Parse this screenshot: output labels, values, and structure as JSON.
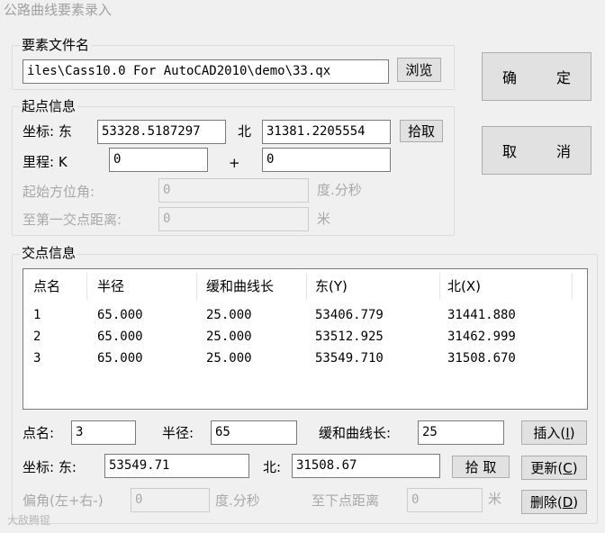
{
  "window": {
    "title": "公路曲线要素录入"
  },
  "file_group": {
    "label": "要素文件名",
    "path": "iles\\Cass10.0 For AutoCAD2010\\demo\\33.qx",
    "browse_label": "浏览"
  },
  "dialog_buttons": {
    "ok_label": [
      "确",
      "定"
    ],
    "cancel_label": [
      "取",
      "消"
    ]
  },
  "start_group": {
    "label": "起点信息",
    "coord_label": "坐标: 东",
    "east": "53328.5187297",
    "north_label": "北",
    "north": "31381.2205554",
    "pick_label": "拾取",
    "mileage_label": "里程:  K",
    "mileage_km": "0",
    "plus": "+",
    "mileage_m": "0",
    "azimuth_label": "起始方位角:",
    "azimuth": "0",
    "azimuth_unit": "度.分秒",
    "first_dist_label": "至第一交点距离:",
    "first_dist": "0",
    "first_dist_unit": "米"
  },
  "ip_group": {
    "label": "交点信息",
    "columns": [
      "点名",
      "半径",
      "缓和曲线长",
      "东(Y)",
      "北(X)"
    ],
    "rows": [
      [
        "1",
        "65.000",
        "25.000",
        "53406.779",
        "31441.880"
      ],
      [
        "2",
        "65.000",
        "25.000",
        "53512.925",
        "31462.999"
      ],
      [
        "3",
        "65.000",
        "25.000",
        "53549.710",
        "31508.670"
      ]
    ],
    "name_label": "点名:",
    "name": "3",
    "radius_label": "半径:",
    "radius": "65",
    "transition_label": "缓和曲线长:",
    "transition": "25",
    "insert_label": "插入(",
    "insert_key": "I",
    "coord_label": "坐标: 东:",
    "east": "53549.71",
    "north_label": "北:",
    "north": "31508.67",
    "pick_label": "拾 取",
    "update_label": "更新(",
    "update_key": "C",
    "deflection_label": "偏角(左+右-)",
    "deflection": "0",
    "deflection_unit": "度.分秒",
    "next_dist_label": "至下点距离",
    "next_dist": "0",
    "next_dist_unit": "米",
    "delete_label": "删除(",
    "delete_key": "D",
    "close_paren": ")"
  },
  "watermark": "大敌腾锟"
}
